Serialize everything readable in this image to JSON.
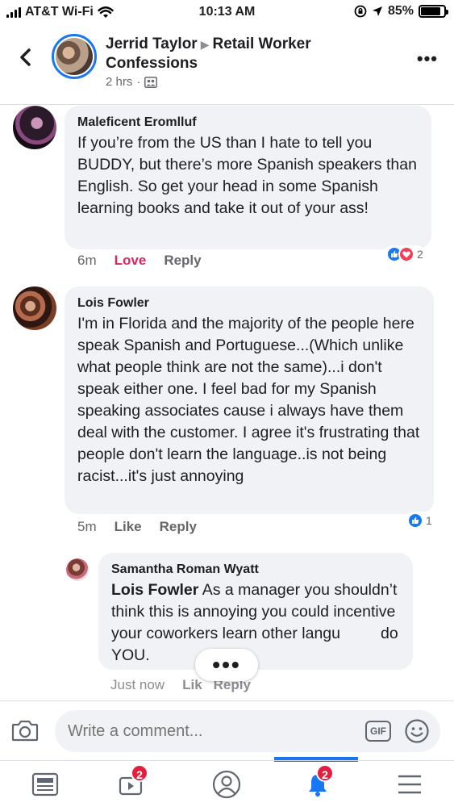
{
  "status_bar": {
    "carrier": "AT&T Wi-Fi",
    "time": "10:13 AM",
    "battery": "85%",
    "battery_level": 0.85
  },
  "header": {
    "poster": "Jerrid Taylor",
    "group": "Retail Worker Confessions",
    "time": "2 hrs",
    "separator": "·",
    "privacy_icon": "group-members-icon"
  },
  "comments": [
    {
      "author": "Maleficent Eromlluf",
      "text": "If you’re from the US than I hate to tell you BUDDY, but there’s more Spanish speakers than English. So get your head in some Spanish learning books and take it out of your ass!",
      "time": "6m",
      "reaction_action": "Love",
      "reply": "Reply",
      "reaction_count": "2",
      "reaction_types": [
        "like",
        "love"
      ]
    },
    {
      "author": "Lois Fowler",
      "text": "I'm in Florida and the majority of the people here speak Spanish and Portuguese...(Which unlike what people think are not the same)...i don't speak either one. I feel bad for my Spanish speaking associates cause i always have them deal with the customer. I agree it's frustrating that people don't learn the language..is not being racist...it's just annoying",
      "time": "5m",
      "reaction_action": "Like",
      "reply": "Reply",
      "reaction_count": "1",
      "reaction_types": [
        "like"
      ]
    }
  ],
  "reply": {
    "author": "Samantha Roman Wyatt",
    "mention": "Lois Fowler",
    "text_a": " As a manager you shouldn’t think this is annoying you could incentive your coworkers learn other langu",
    "text_b": "do YOU.",
    "time": "Just now",
    "like": "Lik",
    "reply": "Reply"
  },
  "typing_indicator": "•••",
  "composer": {
    "placeholder": "Write a comment...",
    "gif_label": "GIF"
  },
  "nav": {
    "video_badge": "2",
    "notifications_badge": "2"
  },
  "colors": {
    "accent": "#1877f2",
    "love": "#e0245e",
    "bubble": "#f0f2f5",
    "badge": "#e41e3f"
  }
}
